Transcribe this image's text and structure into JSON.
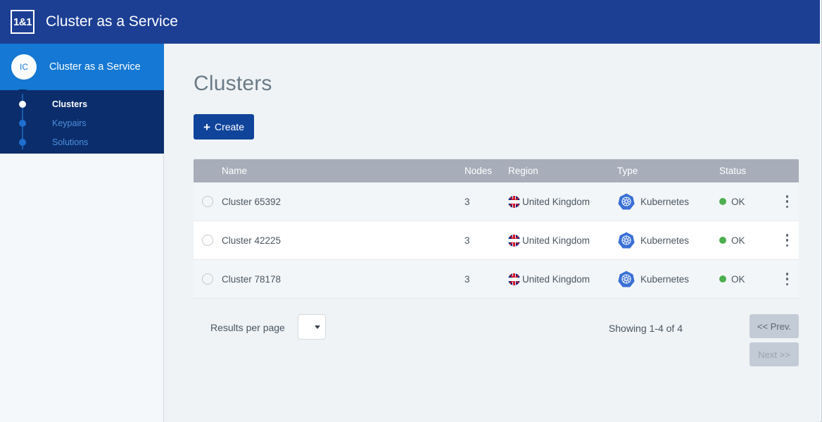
{
  "header": {
    "logo_text": "1&1",
    "title": "Cluster as a Service"
  },
  "sidebar": {
    "avatar_initials": "IC",
    "account_label": "Cluster as a Service",
    "items": [
      {
        "label": "Clusters",
        "active": true
      },
      {
        "label": "Keypairs",
        "active": false
      },
      {
        "label": "Solutions",
        "active": false
      }
    ]
  },
  "main": {
    "page_title": "Clusters",
    "create_button": {
      "icon": "plus-icon",
      "label": "Create"
    },
    "table": {
      "columns": [
        "Name",
        "Nodes",
        "Region",
        "Type",
        "Status"
      ],
      "rows": [
        {
          "name": "Cluster 65392",
          "nodes": "3",
          "region": "United Kingdom",
          "region_icon": "uk-flag-icon",
          "type": "Kubernetes",
          "type_icon": "kubernetes-icon",
          "status": "OK",
          "status_color": "#4caf50"
        },
        {
          "name": "Cluster 42225",
          "nodes": "3",
          "region": "United Kingdom",
          "region_icon": "uk-flag-icon",
          "type": "Kubernetes",
          "type_icon": "kubernetes-icon",
          "status": "OK",
          "status_color": "#4caf50"
        },
        {
          "name": "Cluster 78178",
          "nodes": "3",
          "region": "United Kingdom",
          "region_icon": "uk-flag-icon",
          "type": "Kubernetes",
          "type_icon": "kubernetes-icon",
          "status": "OK",
          "status_color": "#4caf50"
        }
      ]
    },
    "pagination": {
      "results_per_page_label": "Results per page",
      "results_per_page_value": "",
      "showing_text": "Showing 1-4 of 4",
      "prev_label": "<< Prev.",
      "next_label": "Next >>"
    }
  },
  "colors": {
    "topbar": "#1c3f94",
    "sidebar_head": "#1478d4",
    "sidebar_nav": "#0b2d6b",
    "accent_button": "#10449b",
    "table_header": "#a7aeba"
  }
}
